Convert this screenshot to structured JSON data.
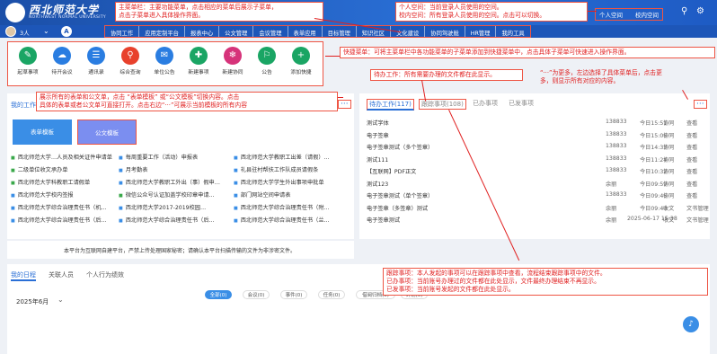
{
  "header": {
    "logo_cn": "西北师范大学",
    "logo_en": "NORTHWEST NORMAL UNIVERSITY",
    "personal_space": "个人空间",
    "school_space": "校内空间"
  },
  "navbar": {
    "user_count": "3人",
    "nav_button": "A",
    "menu": [
      "协同工作",
      "应用定制平台",
      "报表中心",
      "公文管理",
      "会议管理",
      "表单应用",
      "目标管理",
      "知识社区",
      "文化建设",
      "协同驾驶舱",
      "HR管理",
      "我的工具"
    ]
  },
  "quick": {
    "items": [
      {
        "label": "起草事项",
        "icon": "edit-icon",
        "color": "#1aa564"
      },
      {
        "label": "待开会议",
        "icon": "meeting-icon",
        "color": "#2a7de1"
      },
      {
        "label": "通讯录",
        "icon": "contacts-icon",
        "color": "#2a7de1"
      },
      {
        "label": "综合查询",
        "icon": "search-icon",
        "color": "#e8412c"
      },
      {
        "label": "单位公告",
        "icon": "notice-icon",
        "color": "#2a7de1"
      },
      {
        "label": "新建事项",
        "icon": "new-item-icon",
        "color": "#1aa564"
      },
      {
        "label": "新建协同",
        "icon": "collab-icon",
        "color": "#d6337a"
      },
      {
        "label": "公告",
        "icon": "announce-icon",
        "color": "#1aa564"
      },
      {
        "label": "添加快捷",
        "icon": "plus-icon",
        "color": "#1aa564"
      }
    ]
  },
  "annotations": {
    "main_menu": [
      "主菜单栏：主要功能菜单，点击相应的菜单后展示子菜单，",
      "点击子菜单进入具体操作界面。"
    ],
    "space": [
      "个人空间：当前登录人员使用的空间。",
      "校内空间：所有登录人员使用的空间。点击可以切换。"
    ],
    "quick": "快捷菜单：可将主菜单栏中各功能菜单的子菜单添加到快捷菜单中，点击具体子菜单可快速进入操作界面。",
    "forms": [
      "展示所有的表单和公文单，点击 “表单模板” 或“公文模板”切换内容。点击",
      "具体的表单或者公文单可直接打开。点击右边“···”可展示当前模板的所有内容"
    ],
    "todo": "待办工作：所有需要办理的文件都在此显示。",
    "more": [
      "“···”为更多，左边选择了具体菜单后，点击更",
      "多，则显示所有对应的内容。"
    ],
    "tracking": [
      "跟踪事项：本人发起的事项可以在跟踪事项中查看，流程结束跟踪事项中的文件。",
      "已办事项：当前账号办理过的文件都在此处显示，文件最终办理结束不再显示。",
      "已发事项：当前账号发起的文件都在此处显示。"
    ]
  },
  "forms": {
    "title": "我的工作",
    "more": "···",
    "tab_form": "表单模板",
    "tab_doc": "公文模板",
    "items": [
      "西北师范大学…人员及相关证件申请单",
      "每周重要工作（活动）申报表",
      "西北师范大学教职工出差（请假）…",
      "二级单位收文承办单",
      "月考勤表",
      "礼县驻村帮扶工作队成员请假条",
      "西北师范大学科教职工请假单",
      "西北师范大学教职工外出（事）假申…",
      "西北师范大学学生外出事项申批单",
      "西北师范大学校内签报",
      "微信公众号认证加盖学校印章申请…",
      "部门网站空间申请表",
      "西北师范大学综合治理责任书（机…",
      "西北师范大学2017-2019校园…",
      "西北师范大学综合治理责任书（附…",
      "西北师范大学综合治理责任书（后…",
      "西北师范大学综合治理责任书（后…",
      "西北师范大学综合治理责任书（兰…"
    ],
    "footer": "本平台为互联网自建平台，严禁上传处理国家秘密；请确认本平台扫描传输的文件为非涉密文件。"
  },
  "todo": {
    "tabs": [
      "待办工作(117)",
      "跟踪事项(108)",
      "已办事项",
      "已发事项"
    ],
    "more": "···",
    "rows": [
      {
        "title": "测试字体",
        "num": "138833",
        "time": "今日15:51",
        "a": "协同",
        "b": "查看"
      },
      {
        "title": "电子签章",
        "num": "138833",
        "time": "今日15:06",
        "a": "协同",
        "b": "查看"
      },
      {
        "title": "电子签章测试（多个签章）",
        "num": "138833",
        "time": "今日14:33",
        "a": "协同",
        "b": "查看"
      },
      {
        "title": "测试111",
        "num": "138833",
        "time": "今日11:24",
        "a": "协同",
        "b": "查看"
      },
      {
        "title": "【互联网】PDF正文",
        "num": "138833",
        "time": "今日10:32",
        "a": "协同",
        "b": "查看"
      },
      {
        "title": "测试123",
        "num": "余丽",
        "time": "今日09:59",
        "a": "协同",
        "b": "查看"
      },
      {
        "title": "电子签章测试（单个签章）",
        "num": "138833",
        "time": "今日09:46",
        "a": "协同",
        "b": "查看"
      },
      {
        "title": "电子签章（多签章）测试",
        "num": "余丽",
        "time": "今日09:40",
        "a": "收文",
        "b": "文书管理"
      },
      {
        "title": "电子签章测试",
        "num": "余丽",
        "time": "2025-06-17 15:38",
        "a": "收文",
        "b": "文书管理"
      }
    ]
  },
  "schedule": {
    "tabs": [
      "我的日程",
      "关联人员",
      "个人行为绩效"
    ],
    "month": "2025年6月",
    "filters": [
      "全部(0)",
      "会议(0)",
      "事件(0)",
      "任务(0)",
      "借阅归档(0)",
      "计划(0)"
    ]
  },
  "help": "♪"
}
